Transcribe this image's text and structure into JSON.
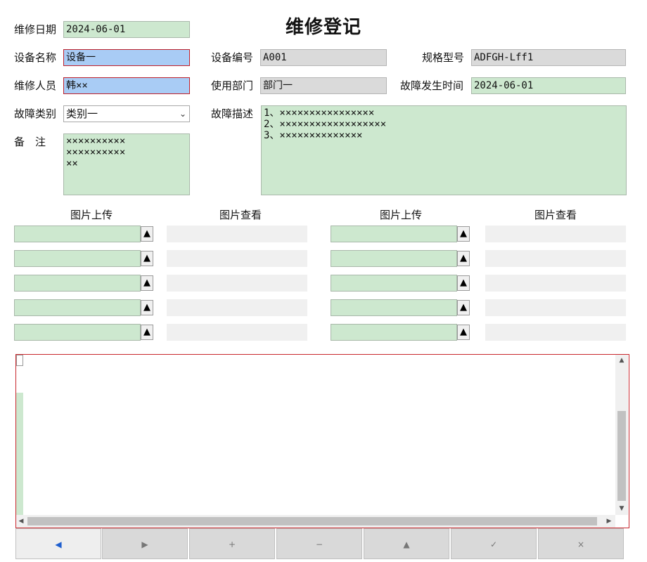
{
  "page": {
    "title": "维修登记"
  },
  "form": {
    "repair_date": {
      "label": "维修日期",
      "value": "2024-06-01"
    },
    "device_name": {
      "label": "设备名称",
      "value": "设备一"
    },
    "device_code": {
      "label": "设备编号",
      "value": "A001"
    },
    "spec_model": {
      "label": "规格型号",
      "value": "ADFGH-Lff1"
    },
    "repairer": {
      "label": "维修人员",
      "value": "韩××"
    },
    "department": {
      "label": "使用部门",
      "value": "部门一"
    },
    "fault_time": {
      "label": "故障发生时间",
      "value": "2024-06-01"
    },
    "fault_type": {
      "label": "故障类别",
      "value": "类别一"
    },
    "fault_desc": {
      "label": "故障描述",
      "value": "1、××××××××××××××××\n2、××××××××××××××××××\n3、××××××××××××××"
    },
    "remark": {
      "label": "备　注",
      "value": "××××××××××\n××××××××××\n××"
    }
  },
  "images": {
    "upload_label": "图片上传",
    "view_label": "图片查看",
    "upload_button_glyph": "▲"
  },
  "navigator": {
    "buttons": [
      {
        "name": "prev",
        "glyph": "◀"
      },
      {
        "name": "next",
        "glyph": "▶"
      },
      {
        "name": "add",
        "glyph": "+"
      },
      {
        "name": "delete",
        "glyph": "−"
      },
      {
        "name": "edit",
        "glyph": "▲"
      },
      {
        "name": "save",
        "glyph": "✓"
      },
      {
        "name": "cancel",
        "glyph": "×"
      }
    ]
  },
  "grid": {
    "scroll_up": "▲",
    "scroll_down": "▼",
    "scroll_left": "◀",
    "scroll_right": "▶"
  }
}
